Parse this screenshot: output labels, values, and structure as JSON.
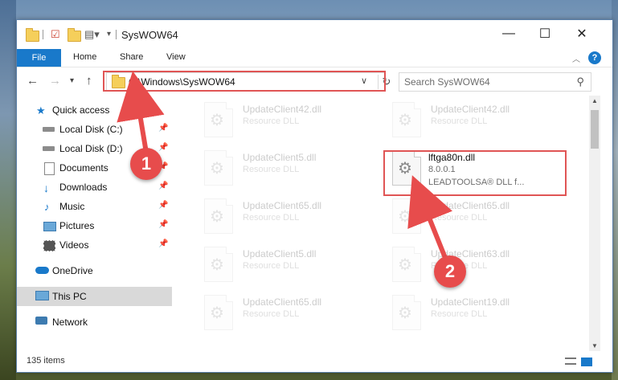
{
  "window": {
    "title": "SysWOW64",
    "minimize_glyph": "—",
    "maximize_glyph": "☐",
    "close_glyph": "✕"
  },
  "ribbon": {
    "file_label": "File",
    "tabs": [
      "Home",
      "Share",
      "View"
    ],
    "help_glyph": "?"
  },
  "address": {
    "path": "C:\\Windows\\SysWOW64",
    "search_placeholder": "Search SysWOW64"
  },
  "nav": {
    "items": [
      {
        "label": "Quick access",
        "icon": "star-icon"
      },
      {
        "label": "Local Disk (C:)",
        "icon": "drive-icon",
        "pinned": true
      },
      {
        "label": "Local Disk (D:)",
        "icon": "drive-icon",
        "pinned": true
      },
      {
        "label": "Documents",
        "icon": "documents-icon",
        "pinned": true
      },
      {
        "label": "Downloads",
        "icon": "downloads-icon",
        "pinned": true
      },
      {
        "label": "Music",
        "icon": "music-icon",
        "pinned": true
      },
      {
        "label": "Pictures",
        "icon": "pictures-icon",
        "pinned": true
      },
      {
        "label": "Videos",
        "icon": "videos-icon",
        "pinned": true
      },
      {
        "label": "OneDrive",
        "icon": "onedrive-icon"
      },
      {
        "label": "This PC",
        "icon": "pc-icon",
        "selected": true
      },
      {
        "label": "Network",
        "icon": "network-icon"
      }
    ]
  },
  "files": [
    {
      "name": "UpdateClient42.dll",
      "type": "Resource DLL"
    },
    {
      "name": "UpdateClient42.dll",
      "type": "Resource DLL"
    },
    {
      "name": "UpdateClient5.dll",
      "type": "Resource DLL"
    },
    {
      "name": "lftga80n.dll",
      "version": "8.0.0.1",
      "description": "LEADTOOLSA® DLL f..."
    },
    {
      "name": "UpdateClient65.dll",
      "type": "Resource DLL"
    },
    {
      "name": "UpdateClient65.dll",
      "type": "Resource DLL"
    },
    {
      "name": "UpdateClient5.dll",
      "type": "Resource DLL"
    },
    {
      "name": "UpdateClient63.dll",
      "type": "Resource DLL"
    },
    {
      "name": "UpdateClient65.dll",
      "type": "Resource DLL"
    },
    {
      "name": "UpdateClient19.dll",
      "type": "Resource DLL"
    }
  ],
  "status": {
    "item_count": "135 items"
  },
  "annotations": {
    "step1": "1",
    "step2": "2",
    "color": "#e74c4c"
  }
}
